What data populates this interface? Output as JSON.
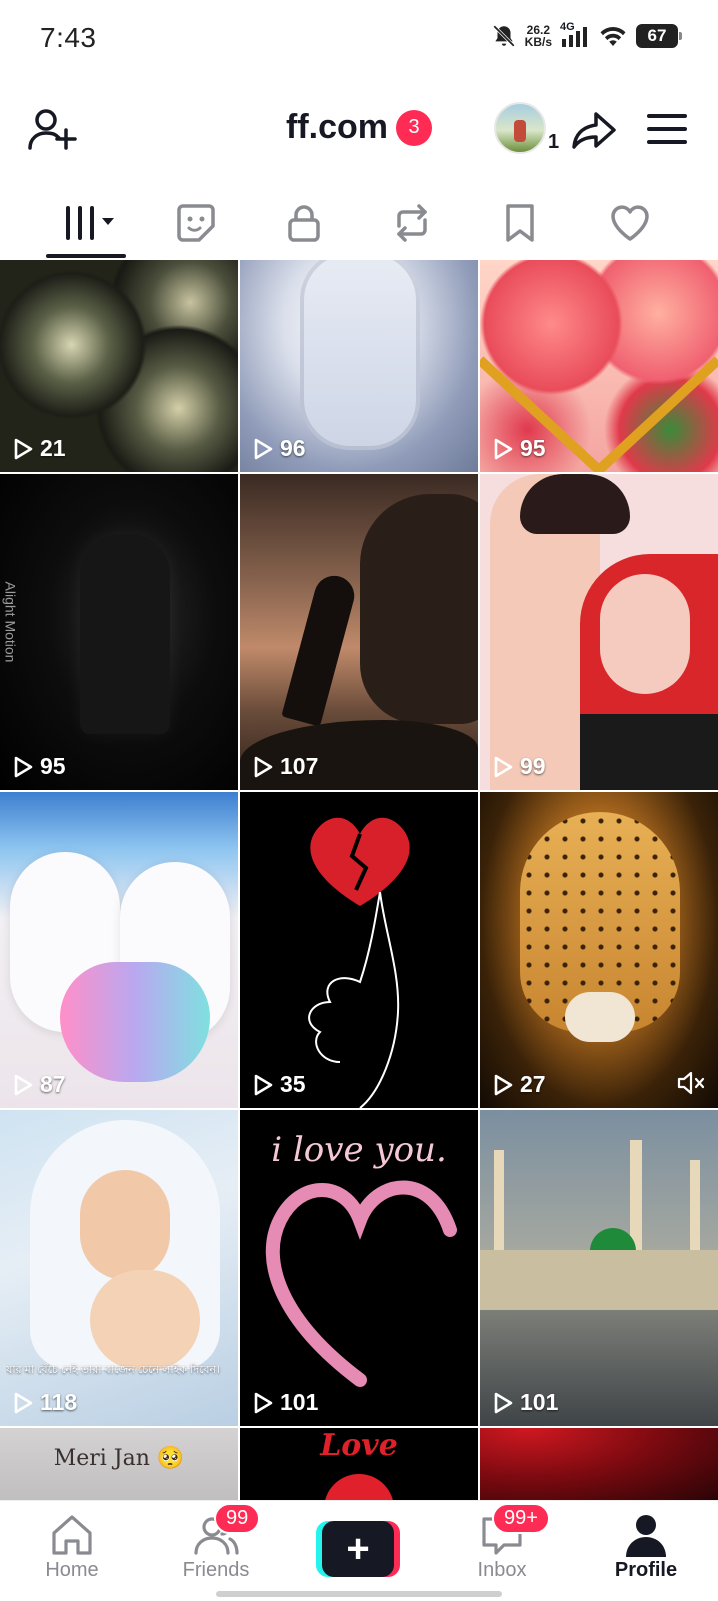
{
  "status_bar": {
    "time": "7:43",
    "net_speed_value": "26.2",
    "net_speed_unit": "KB/s",
    "network": "4G",
    "battery": "67"
  },
  "header": {
    "title": "ff.com",
    "title_badge": "3",
    "account_count": "1"
  },
  "tabs": [
    {
      "name": "videos",
      "icon": "grid-icon",
      "active": true
    },
    {
      "name": "stickers",
      "icon": "sticker-icon"
    },
    {
      "name": "private",
      "icon": "lock-icon"
    },
    {
      "name": "reposts",
      "icon": "repost-icon"
    },
    {
      "name": "favorites",
      "icon": "bookmark-icon"
    },
    {
      "name": "liked",
      "icon": "heart-icon"
    }
  ],
  "videos": [
    {
      "views": "21"
    },
    {
      "views": "96"
    },
    {
      "views": "95"
    },
    {
      "views": "95",
      "watermark": "Alight Motion"
    },
    {
      "views": "107"
    },
    {
      "views": "99"
    },
    {
      "views": "87"
    },
    {
      "views": "35"
    },
    {
      "views": "27",
      "muted": true
    },
    {
      "views": "118",
      "caption": "যার মা বেঁচে নেই তারা বাজেন চেনে লাইক দিবেন।"
    },
    {
      "views": "101",
      "caption": "i love you."
    },
    {
      "views": "101"
    },
    {
      "caption": "Meri Jan 🥺"
    },
    {
      "caption": "Love"
    },
    {}
  ],
  "bottom_nav": {
    "home": "Home",
    "friends": "Friends",
    "friends_badge": "99",
    "create": "+",
    "inbox": "Inbox",
    "inbox_badge": "99+",
    "profile": "Profile"
  }
}
